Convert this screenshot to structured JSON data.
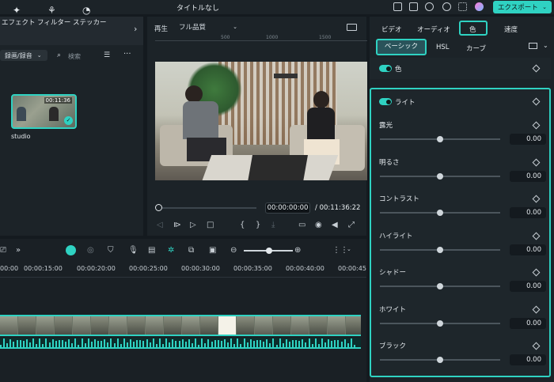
{
  "window": {
    "title": "タイトルなし"
  },
  "toolbar": {
    "export_label": "エクスポート"
  },
  "left_panel": {
    "tabs": [
      {
        "label": "エフェクト",
        "icon": "sparkle-icon"
      },
      {
        "label": "フィルター",
        "icon": "filter-icon"
      },
      {
        "label": "ステッカー",
        "icon": "sticker-icon"
      }
    ],
    "folder_select": "録画/録音",
    "search_placeholder": "検索",
    "clip": {
      "label": "studio",
      "duration": "00:11:36"
    }
  },
  "player": {
    "play_label": "再生",
    "quality": "フル品質",
    "ruler": [
      "500",
      "1000",
      "1500"
    ],
    "current_time": "00:00:00:00",
    "total_time": "/  00:11:36:22"
  },
  "right_panel": {
    "tabs": [
      "ビデオ",
      "オーディオ",
      "色",
      "速度"
    ],
    "active_tab": "色",
    "subtabs": [
      "ベーシック",
      "HSL",
      "カーブ"
    ],
    "active_subtab": "ベーシック",
    "color_section": {
      "label": "色",
      "enabled": true
    },
    "light_section": {
      "label": "ライト",
      "enabled": true
    },
    "params": [
      {
        "label": "露光",
        "value": "0.00",
        "position": 0.5
      },
      {
        "label": "明るさ",
        "value": "0.00",
        "position": 0.5
      },
      {
        "label": "コントラスト",
        "value": "0.00",
        "position": 0.5
      },
      {
        "label": "ハイライト",
        "value": "0.00",
        "position": 0.5
      },
      {
        "label": "シャドー",
        "value": "0.00",
        "position": 0.5
      },
      {
        "label": "ホワイト",
        "value": "0.00",
        "position": 0.5
      },
      {
        "label": "ブラック",
        "value": "0.00",
        "position": 0.5
      }
    ]
  },
  "timeline": {
    "ticks": [
      "00:00",
      "00:00:15:00",
      "00:00:20:00",
      "00:00:25:00",
      "00:00:30:00",
      "00:00:35:00",
      "00:00:40:00",
      "00:00:45"
    ],
    "zoom_level": 0.52
  },
  "colors": {
    "accent": "#2fd2c2",
    "panel": "#1c2328",
    "background": "#141a1f"
  }
}
